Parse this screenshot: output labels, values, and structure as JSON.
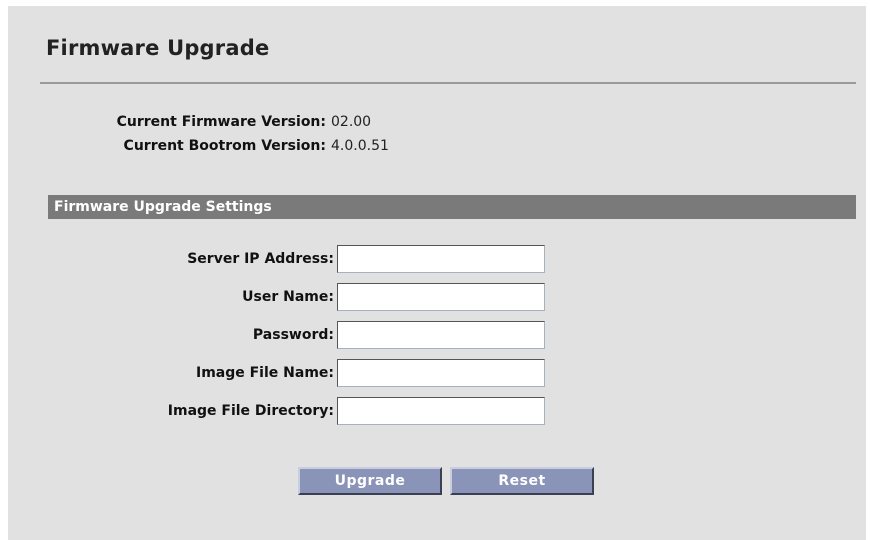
{
  "page": {
    "title": "Firmware Upgrade"
  },
  "info": {
    "firmware_label": "Current Firmware Version:",
    "firmware_value": "02.00",
    "bootrom_label": "Current Bootrom Version:",
    "bootrom_value": "4.0.0.51"
  },
  "settings": {
    "section_title": "Firmware Upgrade Settings",
    "fields": [
      {
        "label": "Server IP Address:",
        "value": ""
      },
      {
        "label": "User Name:",
        "value": ""
      },
      {
        "label": "Password:",
        "value": ""
      },
      {
        "label": "Image File Name:",
        "value": ""
      },
      {
        "label": "Image File Directory:",
        "value": ""
      }
    ]
  },
  "buttons": {
    "upgrade_label": "Upgrade",
    "reset_label": "Reset"
  },
  "colors": {
    "panel_background": "#e1e1e1",
    "section_bar": "#7a7a7a",
    "button": "#8a93b8"
  }
}
